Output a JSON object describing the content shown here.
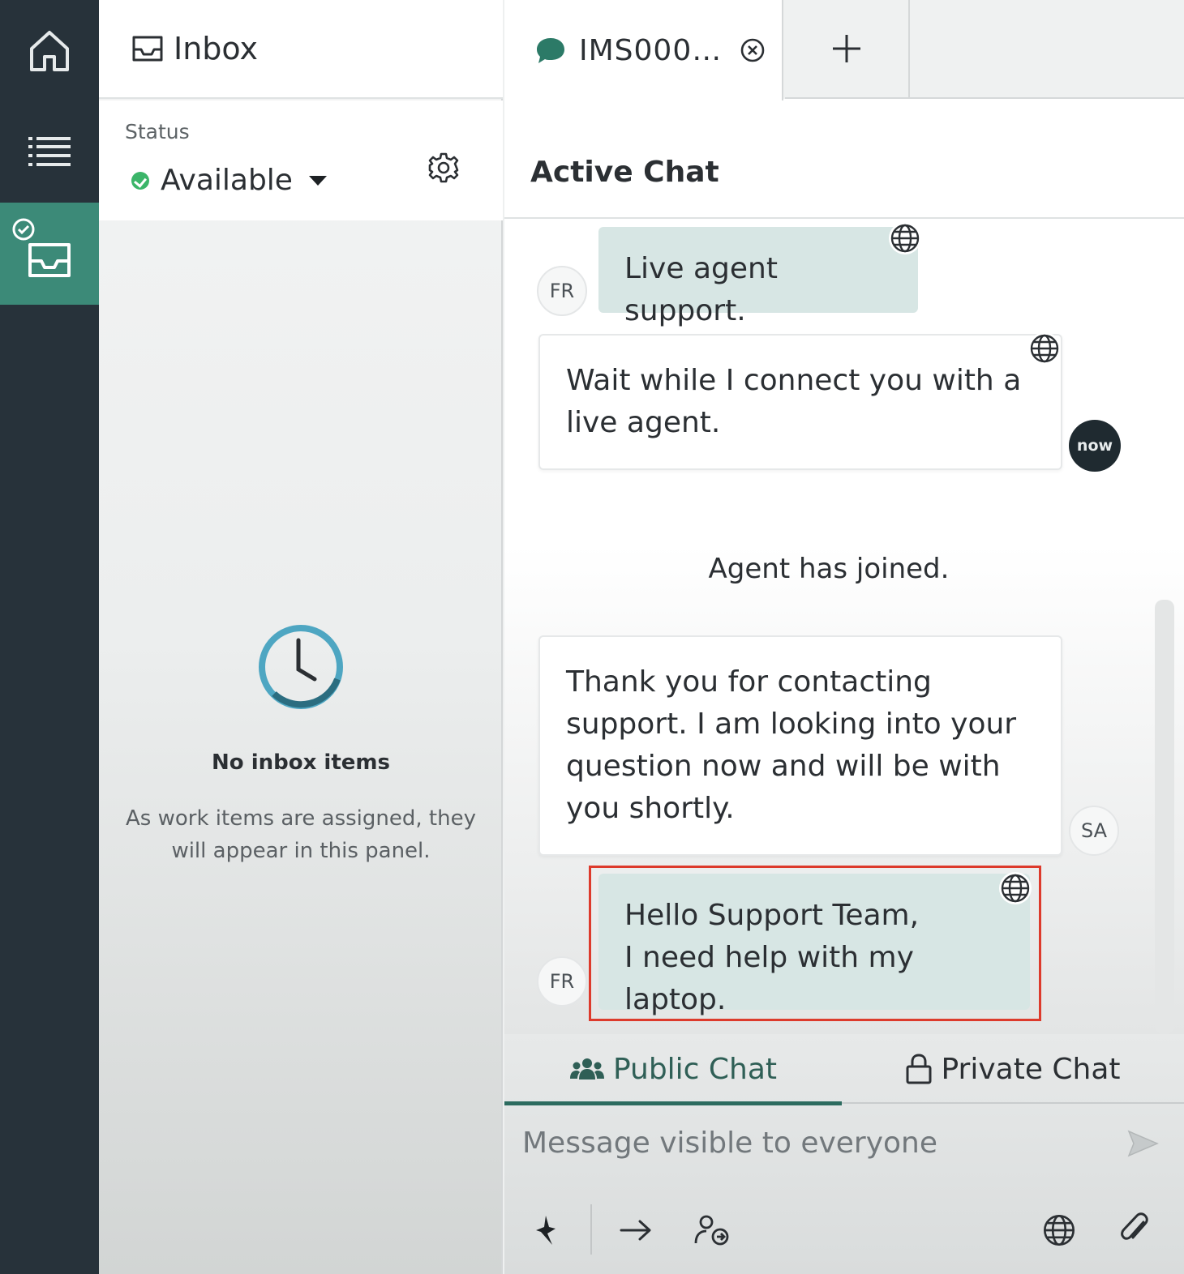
{
  "rail": {
    "items": [
      {
        "name": "home",
        "icon": "home-icon"
      },
      {
        "name": "list",
        "icon": "list-icon"
      },
      {
        "name": "inbox",
        "icon": "inbox-tray-icon",
        "active": true
      }
    ]
  },
  "inbox": {
    "title": "Inbox",
    "status_label": "Status",
    "status_value": "Available",
    "empty_title": "No inbox items",
    "empty_desc": "As work items are assigned, they will appear in this panel."
  },
  "tabs": {
    "active_label": "IMS000…",
    "add_label": "+"
  },
  "chat": {
    "title": "Active Chat",
    "messages": [
      {
        "sender": "FR",
        "type": "user",
        "text": "Live agent support."
      },
      {
        "sender": "now",
        "type": "bot",
        "text": "Wait while I connect you with a live agent."
      },
      {
        "type": "system",
        "text": "Agent has joined."
      },
      {
        "sender": "SA",
        "type": "agent",
        "text": "Thank you for contacting support. I am looking into your question now and will be with you shortly."
      },
      {
        "sender": "FR",
        "type": "user",
        "line1": "Hello Support Team,",
        "line2": "I need help with my laptop."
      }
    ]
  },
  "composer": {
    "public_label": "Public Chat",
    "private_label": "Private Chat",
    "placeholder": "Message visible to everyone"
  },
  "colors": {
    "rail_bg": "#27323a",
    "rail_active": "#3c8a78",
    "user_bubble": "#d7e6e4",
    "highlight": "#dd3a2c",
    "status_available": "#3bb569"
  }
}
